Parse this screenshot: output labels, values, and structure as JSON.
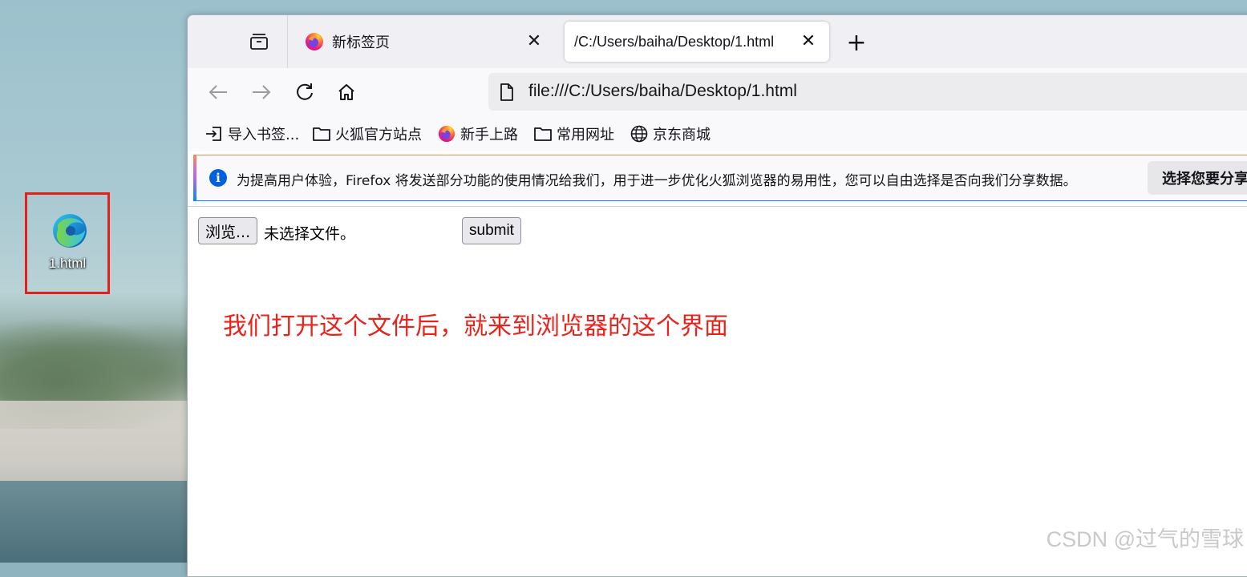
{
  "desktop": {
    "icon_label": "1.html",
    "highlight_color": "#e4201b"
  },
  "browser": {
    "tabs": [
      {
        "title": "新标签页",
        "active": false
      },
      {
        "title": "/C:/Users/baiha/Desktop/1.html",
        "active": true
      }
    ],
    "close_glyph": "✕",
    "new_tab_glyph": "+",
    "url": "file:///C:/Users/baiha/Desktop/1.html",
    "bookmarks": [
      {
        "label": "导入书签...",
        "icon": "import-icon"
      },
      {
        "label": "火狐官方站点",
        "icon": "folder-icon"
      },
      {
        "label": "新手上路",
        "icon": "firefox-icon"
      },
      {
        "label": "常用网址",
        "icon": "folder-icon"
      },
      {
        "label": "京东商城",
        "icon": "globe-icon"
      }
    ],
    "notice": {
      "icon_glyph": "i",
      "message": "为提高用户体验，Firefox 将发送部分功能的使用情况给我们，用于进一步优化火狐浏览器的易用性，您可以自由选择是否向我们分享数据。",
      "button_label": "选择您要分享"
    }
  },
  "page": {
    "file_button_label": "浏览...",
    "file_status": "未选择文件。",
    "submit_label": "submit",
    "annotation": "我们打开这个文件后，就来到浏览器的这个界面",
    "annotation_color": "#e7231b"
  },
  "watermark": "CSDN @过气的雪球"
}
